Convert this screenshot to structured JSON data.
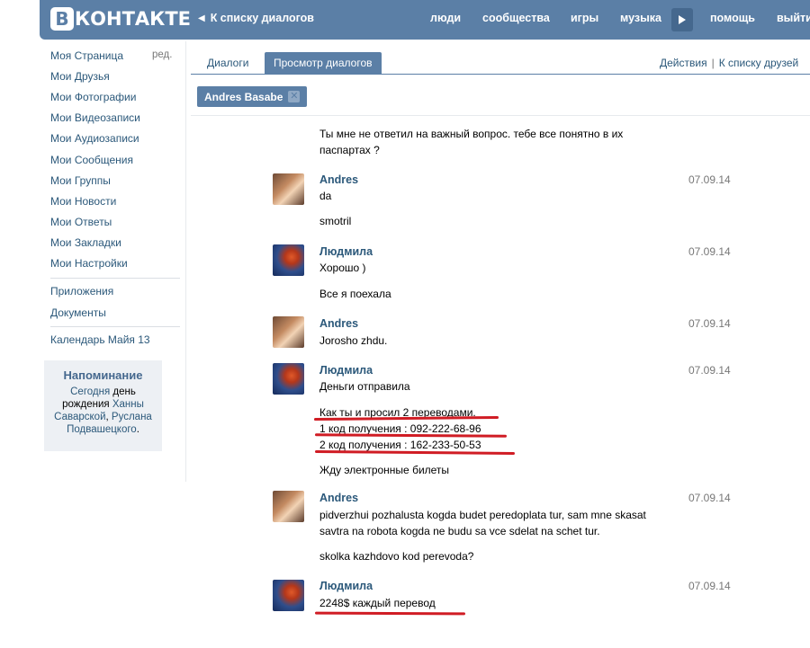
{
  "header": {
    "logo_letter": "В",
    "logo_text": "КОНТАКТЕ",
    "back_label": "К списку диалогов",
    "nav": [
      "люди",
      "сообщества",
      "игры",
      "музыка",
      "помощь",
      "выйти"
    ]
  },
  "sidebar": {
    "items": [
      "Моя Страница",
      "Мои Друзья",
      "Мои Фотографии",
      "Мои Видеозаписи",
      "Мои Аудиозаписи",
      "Мои Сообщения",
      "Мои Группы",
      "Мои Новости",
      "Мои Ответы",
      "Мои Закладки",
      "Мои Настройки"
    ],
    "edit": "ред.",
    "extra": [
      "Приложения",
      "Документы"
    ],
    "calendar": "Календарь Майя 13"
  },
  "reminder": {
    "title": "Напоминание",
    "today": "Сегодня",
    "day_text": "день рождения",
    "person1": "Ханны Саварской",
    "comma": ",",
    "person2": "Руслана Подвашецкого",
    "dot": "."
  },
  "tabs": {
    "dialogs": "Диалоги",
    "view": "Просмотр диалогов",
    "actions": "Действия",
    "separator": "|",
    "to_friends": "К списку друзей"
  },
  "chip": {
    "name": "Andres Basabe",
    "close": "✕"
  },
  "messages": {
    "m0": {
      "lines": [
        "Ты мне не ответил на важный вопрос. тебе все понятно в их",
        "паспартах ?"
      ]
    },
    "m1": {
      "author": "Andres",
      "date": "07.09.14",
      "text1": "da",
      "text2": "smotril"
    },
    "m2": {
      "author": "Людмила",
      "date": "07.09.14",
      "text1": "Хорошо )",
      "text2": "Все я поехала"
    },
    "m3": {
      "author": "Andres",
      "date": "07.09.14",
      "text1": "Jorosho zhdu."
    },
    "m4": {
      "author": "Людмила",
      "date": "07.09.14",
      "text1": "Деньги отправила",
      "text2": "Как ты и просил 2 переводами.",
      "text3": "1 код получения : 092-222-68-96",
      "text4": "2 код получения : 162-233-50-53",
      "text5": "Жду электронные билеты"
    },
    "m5": {
      "author": "Andres",
      "date": "07.09.14",
      "text1": "pidverzhui pozhalusta kogda budet peredoplata tur, sam mne skasat",
      "text2": "savtra na robota kogda ne budu sa vce sdelat na schet tur.",
      "text3": "skolka kazhdovo kod perevoda?"
    },
    "m6": {
      "author": "Людмила",
      "date": "07.09.14",
      "text1": "2248$ каждый перевод"
    }
  },
  "colors": {
    "header_bg": "#5b7fa6",
    "link": "#2b587a",
    "date": "#777777",
    "annotation": "#d01c24"
  },
  "icons": [
    "play-icon",
    "back-chevron-icon",
    "close-icon"
  ]
}
